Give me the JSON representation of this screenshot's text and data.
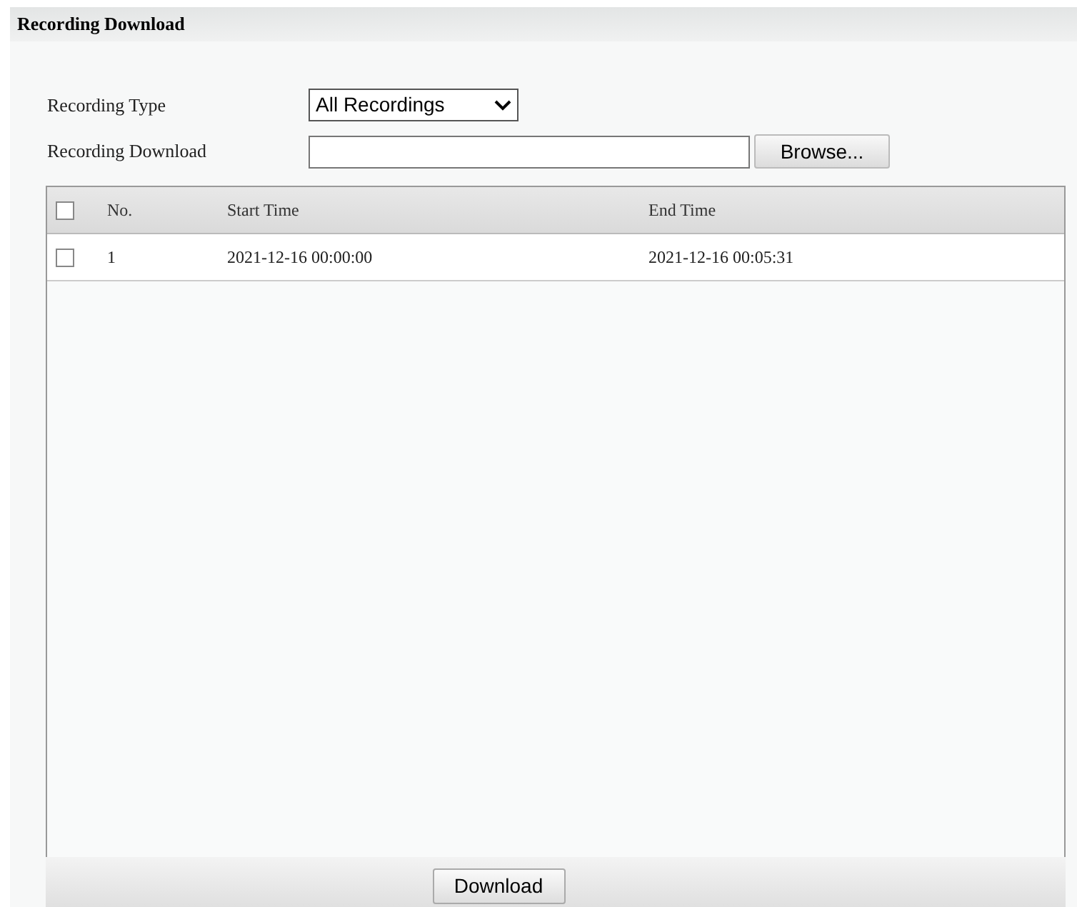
{
  "title": "Recording Download",
  "form": {
    "type_label": "Recording Type",
    "type_value": "All Recordings",
    "download_label": "Recording Download",
    "browse_button": "Browse..."
  },
  "table": {
    "header_checked": false,
    "columns": [
      "No.",
      "Start Time",
      "End Time"
    ],
    "rows": [
      {
        "checked": false,
        "cells": [
          "1",
          "2021-12-16 00:00:00",
          "2021-12-16 00:05:31"
        ]
      }
    ]
  },
  "download_button": "Download"
}
